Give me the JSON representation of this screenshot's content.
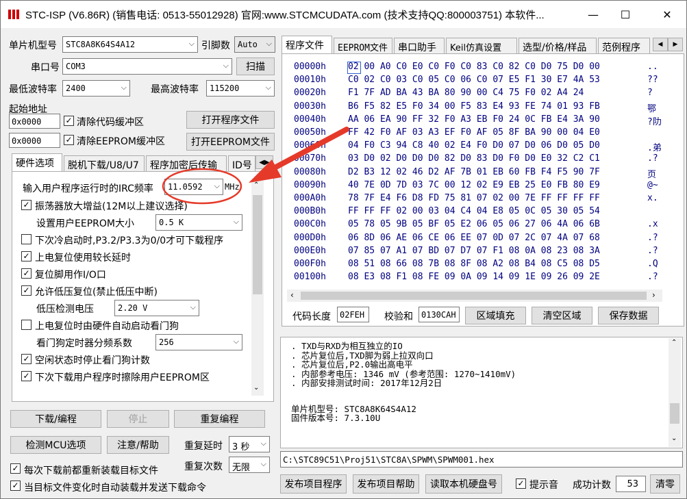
{
  "window": {
    "title": "STC-ISP (V6.86R) (销售电话: 0513-55012928) 官网:www.STCMCUDATA.com  (技术支持QQ:800003751) 本软件...",
    "min": "—",
    "max": "☐",
    "close": "✕"
  },
  "left": {
    "mcu_label": "单片机型号",
    "mcu_value": "STC8A8K64S4A12",
    "pin_label": "引脚数",
    "pin_value": "Auto",
    "port_label": "串口号",
    "port_value": "COM3",
    "scan_btn": "扫描",
    "min_baud_label": "最低波特率",
    "min_baud_value": "2400",
    "max_baud_label": "最高波特率",
    "max_baud_value": "115200",
    "start_addr_label": "起始地址",
    "addr1": "0x0000",
    "clear_code_label": "清除代码缓冲区",
    "open_prog_btn": "打开程序文件",
    "addr2": "0x0000",
    "clear_eeprom_label": "清除EEPROM缓冲区",
    "open_eeprom_btn": "打开EEPROM文件",
    "tabs": [
      "硬件选项",
      "脱机下载/U8/U7",
      "程序加密后传输",
      "ID号"
    ],
    "irc_label": "输入用户程序运行时的IRC频率",
    "irc_value": "11.0592",
    "irc_unit": "MHz",
    "options": [
      {
        "label": "振荡器放大增益(12M以上建议选择)",
        "checked": true
      },
      {
        "label": "设置用户EEPROM大小",
        "checked": null,
        "combo": "0.5 K"
      },
      {
        "label": "下次冷启动时,P3.2/P3.3为0/0才可下载程序",
        "checked": false
      },
      {
        "label": "上电复位使用较长延时",
        "checked": true
      },
      {
        "label": "复位脚用作I/O口",
        "checked": true
      },
      {
        "label": "允许低压复位(禁止低压中断)",
        "checked": true
      },
      {
        "label": "低压检测电压",
        "checked": null,
        "combo": "2.20 V"
      },
      {
        "label": "上电复位时由硬件自动启动看门狗",
        "checked": false
      },
      {
        "label": "看门狗定时器分频系数",
        "checked": null,
        "combo": "256"
      },
      {
        "label": "空闲状态时停止看门狗计数",
        "checked": true
      },
      {
        "label": "下次下载用户程序时擦除用户EEPROM区",
        "checked": true
      }
    ],
    "download_btn": "下载/编程",
    "stop_btn": "停止",
    "reprog_btn": "重复编程",
    "check_mcu_btn": "检测MCU选项",
    "help_btn": "注意/帮助",
    "repeat_delay_label": "重复延时",
    "repeat_delay_value": "3 秒",
    "repeat_count_label": "重复次数",
    "repeat_count_value": "无限",
    "reload_label": "每次下载前都重新装载目标文件",
    "auto_load_label": "当目标文件变化时自动装载并发送下载命令"
  },
  "right": {
    "tabs": [
      "程序文件",
      "EEPROM文件",
      "串口助手",
      "Keil仿真设置",
      "选型/价格/样品",
      "范例程序"
    ],
    "hex_rows": [
      {
        "addr": "00000h",
        "bytes": "02 00 A0 C0 E0 C0 F0 C0 83 C0 82 C0 D0 75 D0 00",
        "ascii": ".."
      },
      {
        "addr": "00010h",
        "bytes": "C0 02 C0 03 C0 05 C0 06 C0 07 E5 F1 30 E7 4A 53",
        "ascii": "??"
      },
      {
        "addr": "00020h",
        "bytes": "F1 7F AD BA 43 BA 80 90 00 C4 75 F0 02 A4 24",
        "ascii": "?"
      },
      {
        "addr": "00030h",
        "bytes": "B6 F5 82 E5 F0 34 00 F5 83 E4 93 FE 74 01 93 FB",
        "ascii": "鄂"
      },
      {
        "addr": "00040h",
        "bytes": "AA 06 EA 90 FF 32 F0 A3 EB F0 24 0C FB E4 3A 90",
        "ascii": "?阞"
      },
      {
        "addr": "00050h",
        "bytes": "FF 42 F0 AF 03 A3 EF F0 AF 05 8F BA 90 00 04 E0",
        "ascii": ""
      },
      {
        "addr": "00060h",
        "bytes": "04 F0 C3 94 C8 40 02 E4 F0 D0 07 D0 06 D0 05 D0",
        "ascii": ".弟"
      },
      {
        "addr": "00070h",
        "bytes": "03 D0 02 D0 D0 D0 82 D0 83 D0 F0 D0 E0 32 C2 C1",
        "ascii": ".?"
      },
      {
        "addr": "00080h",
        "bytes": "D2 B3 12 02 46 D2 AF 7B 01 EB 60 FB F4 F5 90 7F",
        "ascii": "页"
      },
      {
        "addr": "00090h",
        "bytes": "40 7E 0D 7D 03 7C 00 12 02 E9 EB 25 E0 FB 80 E9",
        "ascii": "@~"
      },
      {
        "addr": "000A0h",
        "bytes": "78 7F E4 F6 D8 FD 75 81 07 02 00 7E FF FF FF FF",
        "ascii": "x."
      },
      {
        "addr": "000B0h",
        "bytes": "FF FF FF 02 00 03 04 C4 04 E8 05 0C 05 30 05 54",
        "ascii": ""
      },
      {
        "addr": "000C0h",
        "bytes": "05 78 05 9B 05 BF 05 E2 06 05 06 27 06 4A 06 6B",
        "ascii": ".x"
      },
      {
        "addr": "000D0h",
        "bytes": "06 8D 06 AE 06 CE 06 EE 07 0D 07 2C 07 4A 07 68",
        "ascii": ".?"
      },
      {
        "addr": "000E0h",
        "bytes": "07 85 07 A1 07 BD 07 D7 07 F1 08 0A 08 23 08 3A",
        "ascii": ".?"
      },
      {
        "addr": "000F0h",
        "bytes": "08 51 08 66 08 7B 08 8F 08 A2 08 B4 08 C5 08 D5",
        "ascii": ".Q"
      },
      {
        "addr": "00100h",
        "bytes": "08 E3 08 F1 08 FE 09 0A 09 14 09 1E 09 26 09 2E",
        "ascii": ".?"
      }
    ],
    "code_len_label": "代码长度",
    "code_len_value": "02FEH",
    "checksum_label": "校验和",
    "checksum_value": "0130CAH",
    "fill_btn": "区域填充",
    "clear_btn": "清空区域",
    "save_btn": "保存数据",
    "messages": [
      ". TXD与RXD为相互独立的IO",
      ". 芯片复位后,TXD脚为弱上拉双向口",
      ". 芯片复位后,P2.0输出高电平",
      ". 内部参考电压: 1346 mV (参考范围: 1270~1410mV)",
      ". 内部安排测试时间: 2017年12月2日",
      "",
      "单片机型号: STC8A8K64S4A12",
      "固件版本号: 7.3.10U"
    ],
    "file_path": "C:\\STC89C51\\Proj51\\STC8A\\SPWM\\SPWM001.hex",
    "publish_btn": "发布项目程序",
    "publish_help_btn": "发布项目帮助",
    "read_disk_btn": "读取本机硬盘号",
    "sound_label": "提示音",
    "success_label": "成功计数",
    "success_value": "53",
    "reset_btn": "清零"
  }
}
